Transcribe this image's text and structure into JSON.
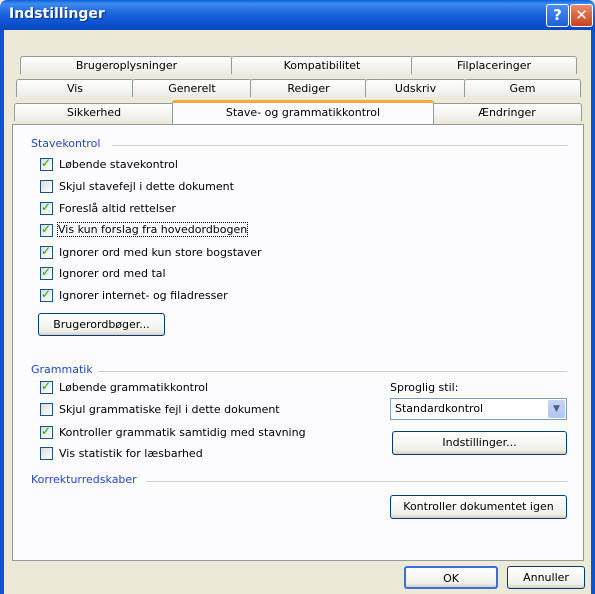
{
  "window": {
    "title": "Indstillinger"
  },
  "tabs": {
    "row1": [
      "Brugeroplysninger",
      "Kompatibilitet",
      "Filplaceringer"
    ],
    "row2": [
      "Vis",
      "Generelt",
      "Rediger",
      "Udskriv",
      "Gem"
    ],
    "row3": [
      "Sikkerhed",
      "Stave- og grammatikkontrol",
      "Ændringer"
    ],
    "active": "Stave- og grammatikkontrol"
  },
  "spelling": {
    "group_label": "Stavekontrol",
    "options": [
      {
        "label": "Løbende stavekontrol",
        "checked": true
      },
      {
        "label": "Skjul stavefejl i dette dokument",
        "checked": false
      },
      {
        "label": "Foreslå altid rettelser",
        "checked": true
      },
      {
        "label": "Vis kun forslag fra hovedordbogen",
        "checked": true
      },
      {
        "label": "Ignorer ord med kun store bogstaver",
        "checked": true
      },
      {
        "label": "Ignorer ord med tal",
        "checked": true
      },
      {
        "label": "Ignorer internet- og filadresser",
        "checked": true
      }
    ],
    "dictionaries_button": "Brugerordbøger..."
  },
  "grammar": {
    "group_label": "Grammatik",
    "options": [
      {
        "label": "Løbende grammatikkontrol",
        "checked": true
      },
      {
        "label": "Skjul grammatiske fejl i dette dokument",
        "checked": false
      },
      {
        "label": "Kontroller grammatik samtidig med stavning",
        "checked": true
      },
      {
        "label": "Vis statistik for læsbarhed",
        "checked": false
      }
    ],
    "style_label": "Sproglig stil:",
    "style_value": "Standardkontrol",
    "settings_button": "Indstillinger..."
  },
  "proofing": {
    "group_label": "Korrekturredskaber",
    "recheck_button": "Kontroller dokumentet igen"
  },
  "footer": {
    "ok_label": "OK",
    "cancel_label": "Annuller"
  }
}
